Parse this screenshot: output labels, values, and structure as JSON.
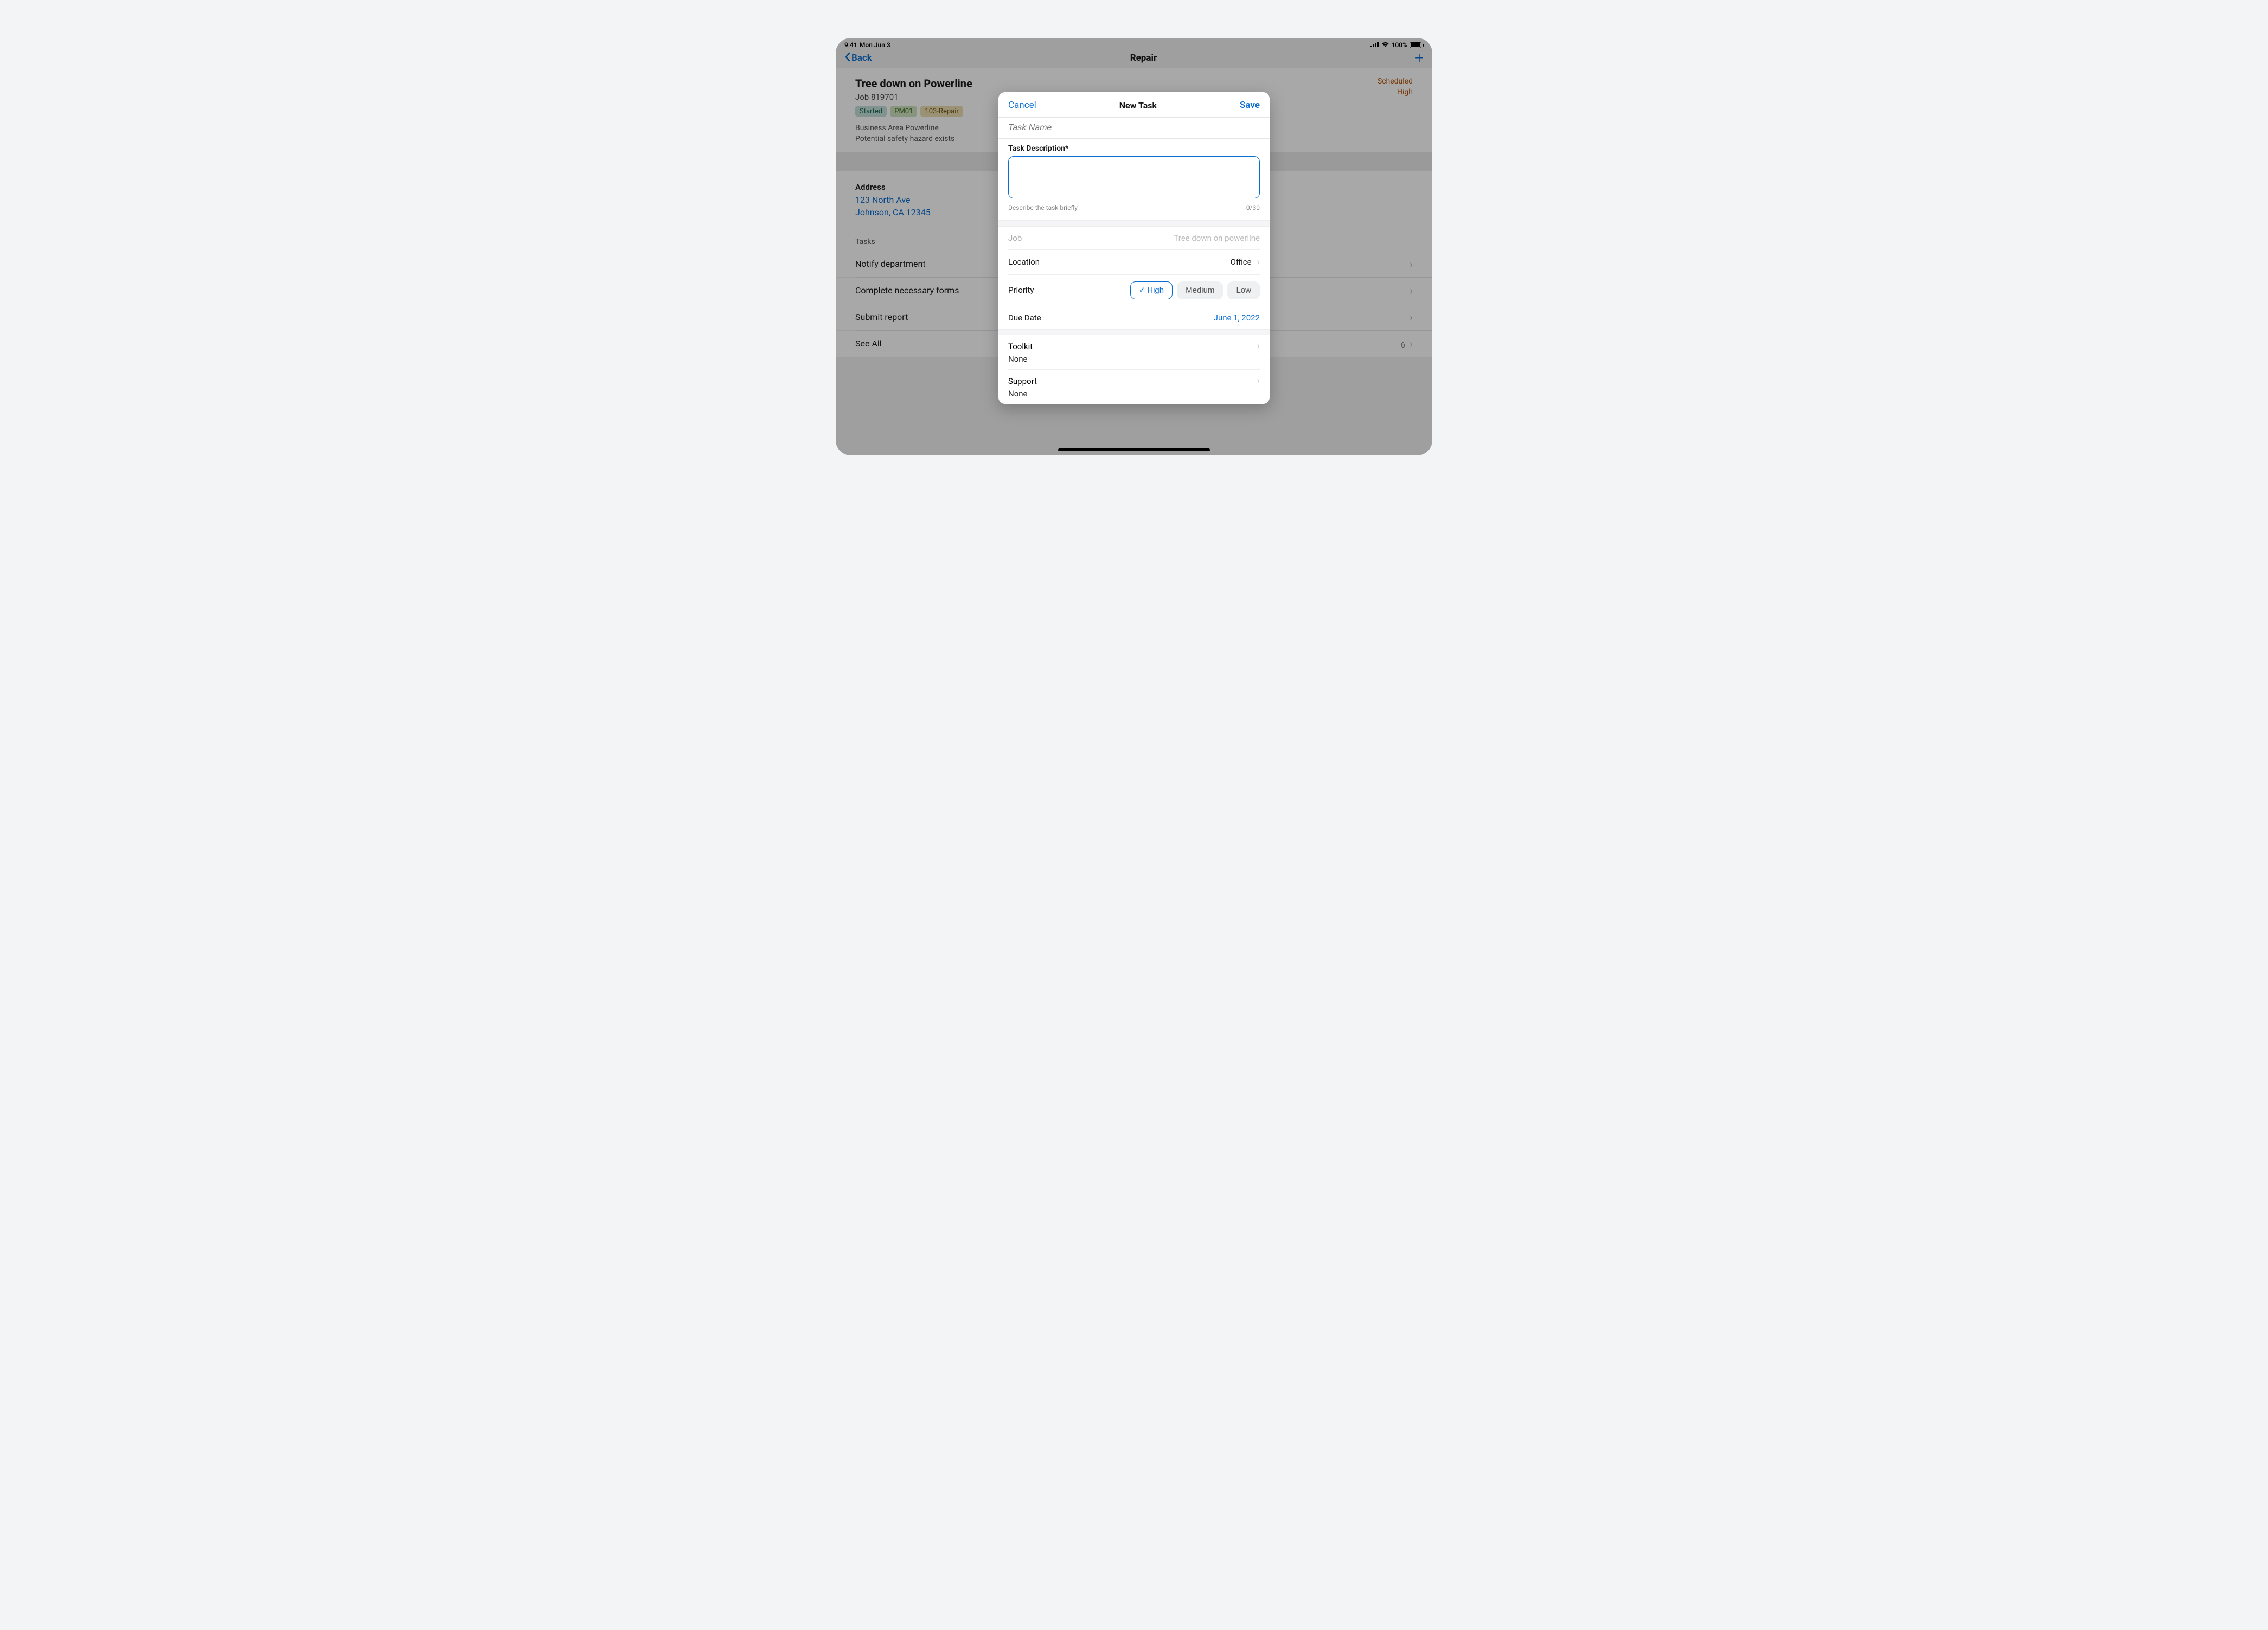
{
  "status_bar": {
    "time": "9:41",
    "date": "Mon Jun 3",
    "battery_pct": "100%"
  },
  "nav": {
    "back_label": "Back",
    "title": "Repair",
    "add_icon": "+"
  },
  "job": {
    "title": "Tree down on Powerline",
    "id_label": "Job 819701",
    "tags": {
      "started": "Started",
      "pm": "PM01",
      "repair": "103-Repair"
    },
    "desc_line1": "Business Area Powerline",
    "desc_line2": "Potential safety hazard exists",
    "scheduled": "Scheduled",
    "priority": "High"
  },
  "address": {
    "label": "Address",
    "line1": "123 North Ave",
    "line2": "Johnson, CA 12345"
  },
  "tasks": {
    "header": "Tasks",
    "items": {
      "0": "Notify department",
      "1": "Complete necessary forms",
      "2": "Submit report"
    },
    "see_all": "See All",
    "count": "6"
  },
  "modal": {
    "cancel": "Cancel",
    "title": "New Task",
    "save": "Save",
    "task_name_placeholder": "Task Name",
    "desc_label": "Task Description*",
    "desc_hint": "Describe the task briefly",
    "desc_counter": "0/30",
    "job_label": "Job",
    "job_value": "Tree down on powerline",
    "location_label": "Location",
    "location_value": "Office",
    "priority_label": "Priority",
    "priority": {
      "high": "High",
      "medium": "Medium",
      "low": "Low"
    },
    "due_label": "Due Date",
    "due_value": "June 1, 2022",
    "toolkit_label": "Toolkit",
    "toolkit_value": "None",
    "support_label": "Support",
    "support_value": "None"
  }
}
